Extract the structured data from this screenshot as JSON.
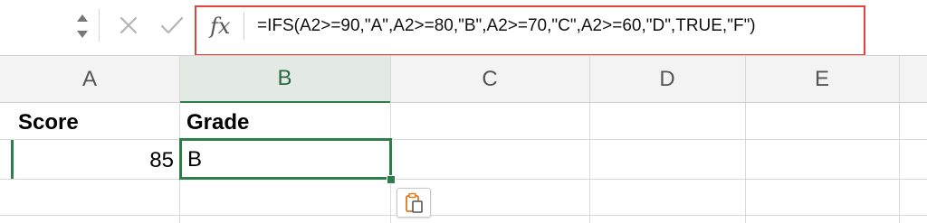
{
  "formula_bar": {
    "fx_label": "fx",
    "formula": "=IFS(A2>=90,\"A\",A2>=80,\"B\",A2>=70,\"C\",A2>=60,\"D\",TRUE,\"F\")",
    "highlight_color": "#e2433a"
  },
  "columns": [
    "A",
    "B",
    "C",
    "D",
    "E"
  ],
  "selected_column": "B",
  "rows": [
    {
      "A": "Score",
      "B": "Grade"
    },
    {
      "A": "85",
      "B": "B"
    }
  ],
  "accent_color": "#2e7d4a",
  "icons": {
    "name_box_stepper": "up-down-arrows-icon",
    "cancel": "close-icon",
    "enter": "checkmark-icon",
    "paste_options": "clipboard-icon"
  }
}
